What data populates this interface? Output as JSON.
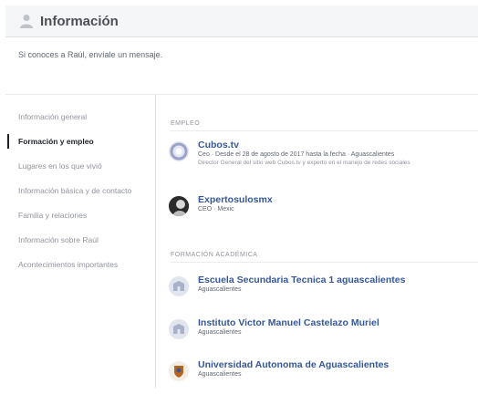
{
  "header": {
    "title": "Información",
    "icon": "person-icon"
  },
  "intro": {
    "text": "Si conoces a Raúl, envíale un mensaje."
  },
  "sidebar": {
    "items": [
      {
        "label": "Información general",
        "active": false
      },
      {
        "label": "Formación y empleo",
        "active": true
      },
      {
        "label": "Lugares en los que vivió",
        "active": false
      },
      {
        "label": "Información básica y de contacto",
        "active": false
      },
      {
        "label": "Familia y relaciones",
        "active": false
      },
      {
        "label": "Información sobre Raúl",
        "active": false
      },
      {
        "label": "Acontecimientos importantes",
        "active": false
      }
    ]
  },
  "work": {
    "title": "EMPLEO",
    "entries": [
      {
        "name": "Cubos.tv",
        "sub": "Ceo · Desde el 28 de agosto de 2017 hasta la fecha · Aguascalientes",
        "desc": "Director General del sitio web Cubos.tv y experto en el manejo de redes sociales",
        "icon": "circle-logo-icon"
      },
      {
        "name": "Expertosulosmx",
        "sub": "CEO · Mexic",
        "icon": "profile-photo-icon"
      }
    ]
  },
  "education": {
    "title": "FORMACIÓN ACADÉMICA",
    "entries": [
      {
        "name": "Escuela Secundaria Tecnica 1 aguascalientes",
        "sub": "Aguascalientes",
        "icon": "school-icon"
      },
      {
        "name": "Instituto Victor Manuel Castelazo Muriel",
        "sub": "Aguascalientes",
        "icon": "school-icon"
      },
      {
        "name": "Universidad Autonoma de Aguascalientes",
        "sub": "Aguascalientes",
        "icon": "university-crest-icon"
      }
    ]
  },
  "colors": {
    "link": "#365899",
    "muted": "#90949c",
    "header_bg": "#f5f6f7"
  }
}
